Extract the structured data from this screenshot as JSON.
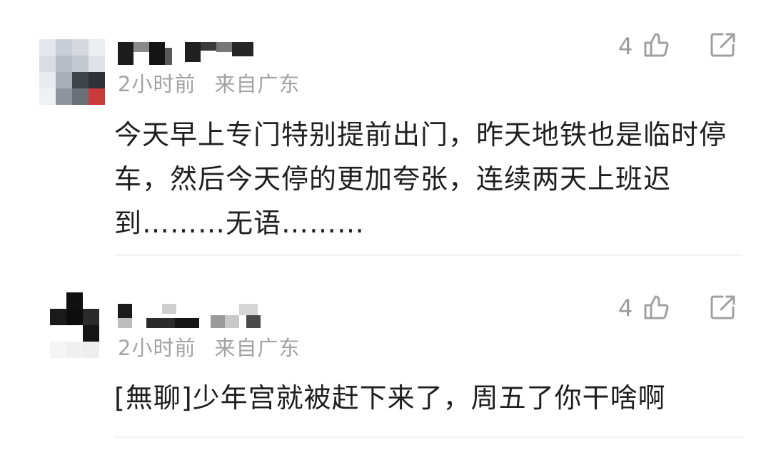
{
  "comments": [
    {
      "time": "2小时前",
      "location": "来自广东",
      "likes": "4",
      "text": "今天早上专门特别提前出门，昨天地铁也是临时停车，然后今天停的更加夸张，连续两天上班迟到………无语………",
      "icons": [
        "thumbs-up-icon",
        "share-icon"
      ]
    },
    {
      "time": "2小时前",
      "location": "来自广东",
      "likes": "4",
      "text": "[無聊]少年宫就被赶下来了，周五了你干啥啊",
      "icons": [
        "thumbs-up-icon",
        "share-icon"
      ]
    }
  ],
  "colors": {
    "meta": "#a3a3a3",
    "text": "#1f1f1f",
    "divider": "#f2f2f2",
    "icon": "#a0a0a0"
  }
}
